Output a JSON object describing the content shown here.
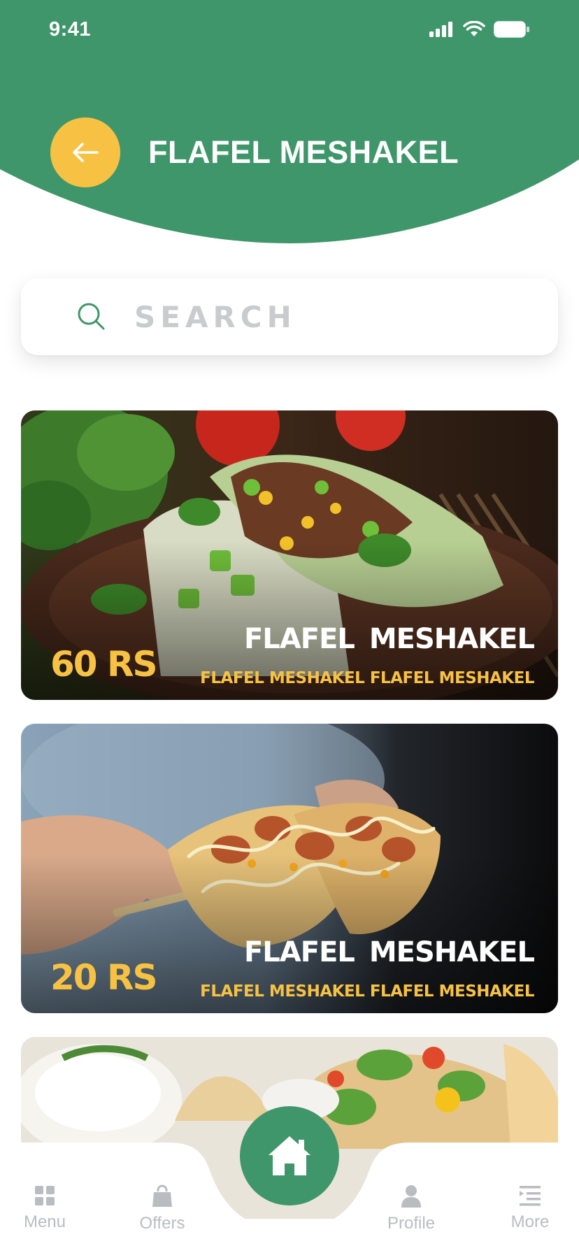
{
  "status_bar": {
    "time": "9:41"
  },
  "header": {
    "title": "FLAFEL MESHAKEL",
    "back_icon": "arrow-left-icon"
  },
  "search": {
    "placeholder": "SEARCH",
    "value": ""
  },
  "items": [
    {
      "price": "60 RS",
      "name": "FLAFEL  MESHAKEL",
      "subtitle": "FLAFEL  MESHAKEL FLAFEL  MESHAKEL"
    },
    {
      "price": "20 RS",
      "name": "FLAFEL  MESHAKEL",
      "subtitle": "FLAFEL  MESHAKEL FLAFEL  MESHAKEL"
    },
    {
      "price": "",
      "name": "",
      "subtitle": ""
    }
  ],
  "bottom_nav": {
    "menu": {
      "label": "Menu",
      "icon": "grid-icon"
    },
    "offers": {
      "label": "Offers",
      "icon": "shopping-bag-icon"
    },
    "home": {
      "icon": "home-icon"
    },
    "profile": {
      "label": "Profile",
      "icon": "user-icon"
    },
    "more": {
      "label": "More",
      "icon": "list-icon"
    }
  },
  "colors": {
    "primary": "#3f966a",
    "accent": "#f7c244",
    "nav_label": "#b9bdc1",
    "placeholder": "#c9cccf"
  }
}
